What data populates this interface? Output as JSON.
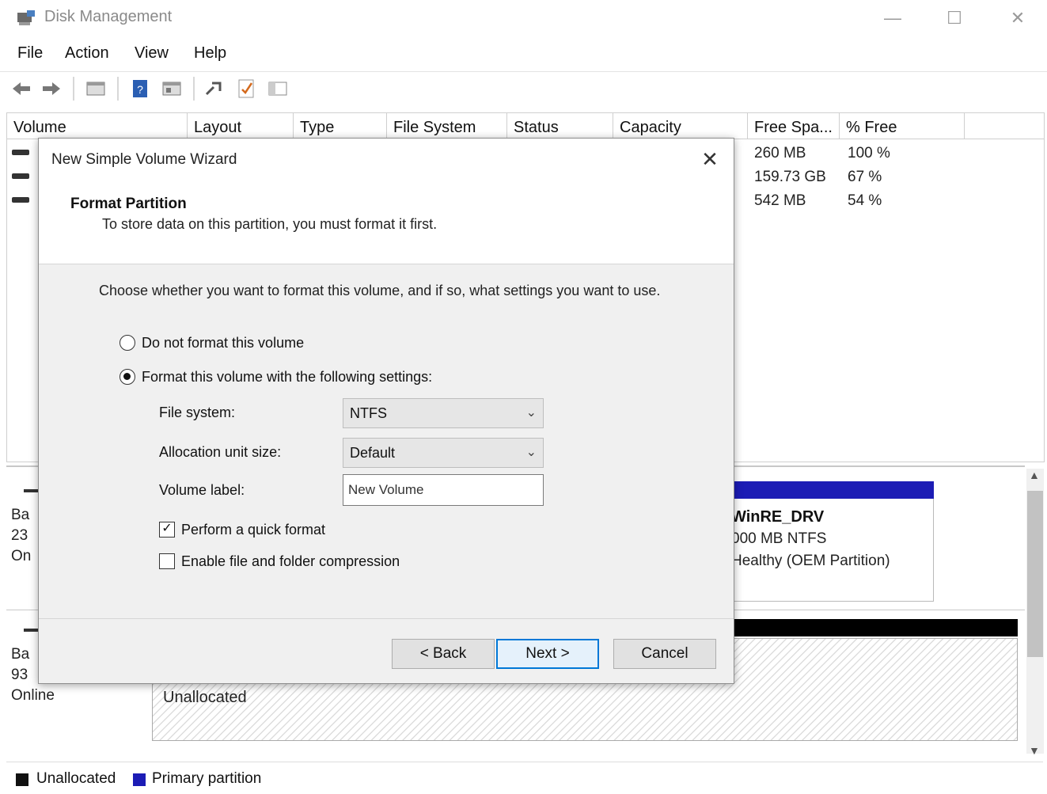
{
  "window": {
    "title": "Disk Management",
    "controls": {
      "minimize": "—",
      "maximize": "☐",
      "close": "✕"
    }
  },
  "menu": [
    "File",
    "Action",
    "View",
    "Help"
  ],
  "toolbar_icons": [
    "back-arrow-icon",
    "forward-arrow-icon",
    "disk-list-icon",
    "help-icon",
    "properties-icon",
    "connect-icon",
    "check-icon",
    "console-icon"
  ],
  "list": {
    "columns": [
      "Volume",
      "Layout",
      "Type",
      "File System",
      "Status",
      "Capacity",
      "Free Spa...",
      "% Free"
    ],
    "rows": [
      {
        "free": "260 MB",
        "pct": "100 %"
      },
      {
        "free": "159.73 GB",
        "pct": "67 %"
      },
      {
        "free": "542 MB",
        "pct": "54 %"
      }
    ]
  },
  "disks": {
    "disk0": {
      "line1": "Ba",
      "line2": "23",
      "line3": "On"
    },
    "disk1": {
      "line1": "Ba",
      "line2": "93",
      "line3": "Online"
    },
    "partition": {
      "name": "WinRE_DRV",
      "size": "000 MB NTFS",
      "status": "Healthy (OEM Partition)"
    },
    "unallocated_label": "Unallocated"
  },
  "legend": [
    {
      "label": "Unallocated",
      "color": "#111111"
    },
    {
      "label": "Primary partition",
      "color": "#1c1cb5"
    }
  ],
  "wizard": {
    "title": "New Simple Volume Wizard",
    "close": "✕",
    "heading": "Format Partition",
    "subheading": "To store data on this partition, you must format it first.",
    "instruction": "Choose whether you want to format this volume, and if so, what settings you want to use.",
    "options": {
      "no_format": "Do not format this volume",
      "format": "Format this volume with the following settings:"
    },
    "selected_option": "format",
    "fields": {
      "file_system_label": "File system:",
      "file_system_value": "NTFS",
      "allocation_label": "Allocation unit size:",
      "allocation_value": "Default",
      "volume_label_label": "Volume label:",
      "volume_label_value": "New Volume"
    },
    "checks": {
      "quick_format": "Perform a quick format",
      "quick_format_checked": true,
      "compression": "Enable file and folder compression",
      "compression_checked": false
    },
    "buttons": {
      "back": "< Back",
      "next": "Next >",
      "cancel": "Cancel"
    }
  }
}
